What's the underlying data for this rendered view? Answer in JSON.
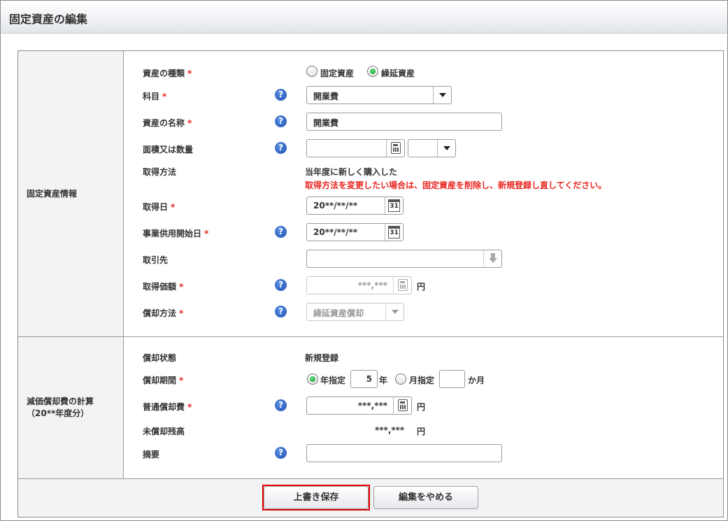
{
  "window": {
    "title": "固定資産の編集"
  },
  "sections": {
    "asset_info": {
      "label": "固定資産情報"
    },
    "depreciation": {
      "label_line1": "減価償却費の計算",
      "label_line2": "（20**年度分）"
    }
  },
  "fields": {
    "asset_type": {
      "label": "資産の種類",
      "required": "*",
      "options": [
        {
          "label": "固定資産",
          "selected": false
        },
        {
          "label": "繰延資産",
          "selected": true
        }
      ]
    },
    "account": {
      "label": "科目",
      "required": "*",
      "value": "開業費"
    },
    "asset_name": {
      "label": "資産の名称",
      "required": "*",
      "value": "開業費"
    },
    "area_quantity": {
      "label": "面積又は数量",
      "value": "",
      "unit_value": ""
    },
    "acquisition_method": {
      "label": "取得方法",
      "value": "当年度に新しく購入した",
      "warning": "取得方法を変更したい場合は、固定資産を削除し、新規登録し直してください。"
    },
    "acquisition_date": {
      "label": "取得日",
      "required": "*",
      "value": "20**/**/**",
      "calendar_day": "31"
    },
    "service_start_date": {
      "label": "事業供用開始日",
      "required": "*",
      "value": "20**/**/**",
      "calendar_day": "31"
    },
    "supplier": {
      "label": "取引先",
      "value": ""
    },
    "acquisition_price": {
      "label": "取得価額",
      "required": "*",
      "value": "***,***",
      "unit": "円"
    },
    "depreciation_method": {
      "label": "償却方法",
      "required": "*",
      "value": "繰延資産償却"
    },
    "depreciation_status": {
      "label": "償却状態",
      "value": "新規登録"
    },
    "depreciation_period": {
      "label": "償却期間",
      "required": "*",
      "year_option": {
        "label": "年指定",
        "selected": true,
        "value": "5",
        "unit": "年"
      },
      "month_option": {
        "label": "月指定",
        "selected": false,
        "value": "",
        "unit": "か月"
      }
    },
    "ordinary_depreciation": {
      "label": "普通償却費",
      "required": "*",
      "value": "***,***",
      "unit": "円"
    },
    "undepreciated_balance": {
      "label": "未償却残高",
      "value": "***,***",
      "unit": "円"
    },
    "summary": {
      "label": "摘要",
      "value": ""
    }
  },
  "help_icon": {
    "glyph": "?"
  },
  "buttons": {
    "save": "上書き保存",
    "cancel": "編集をやめる"
  },
  "colors": {
    "required": "#e8251f",
    "warning": "#e8251f",
    "highlight": "#e00000",
    "radio_on": "#149a2c",
    "help": "#1b4fb5"
  }
}
